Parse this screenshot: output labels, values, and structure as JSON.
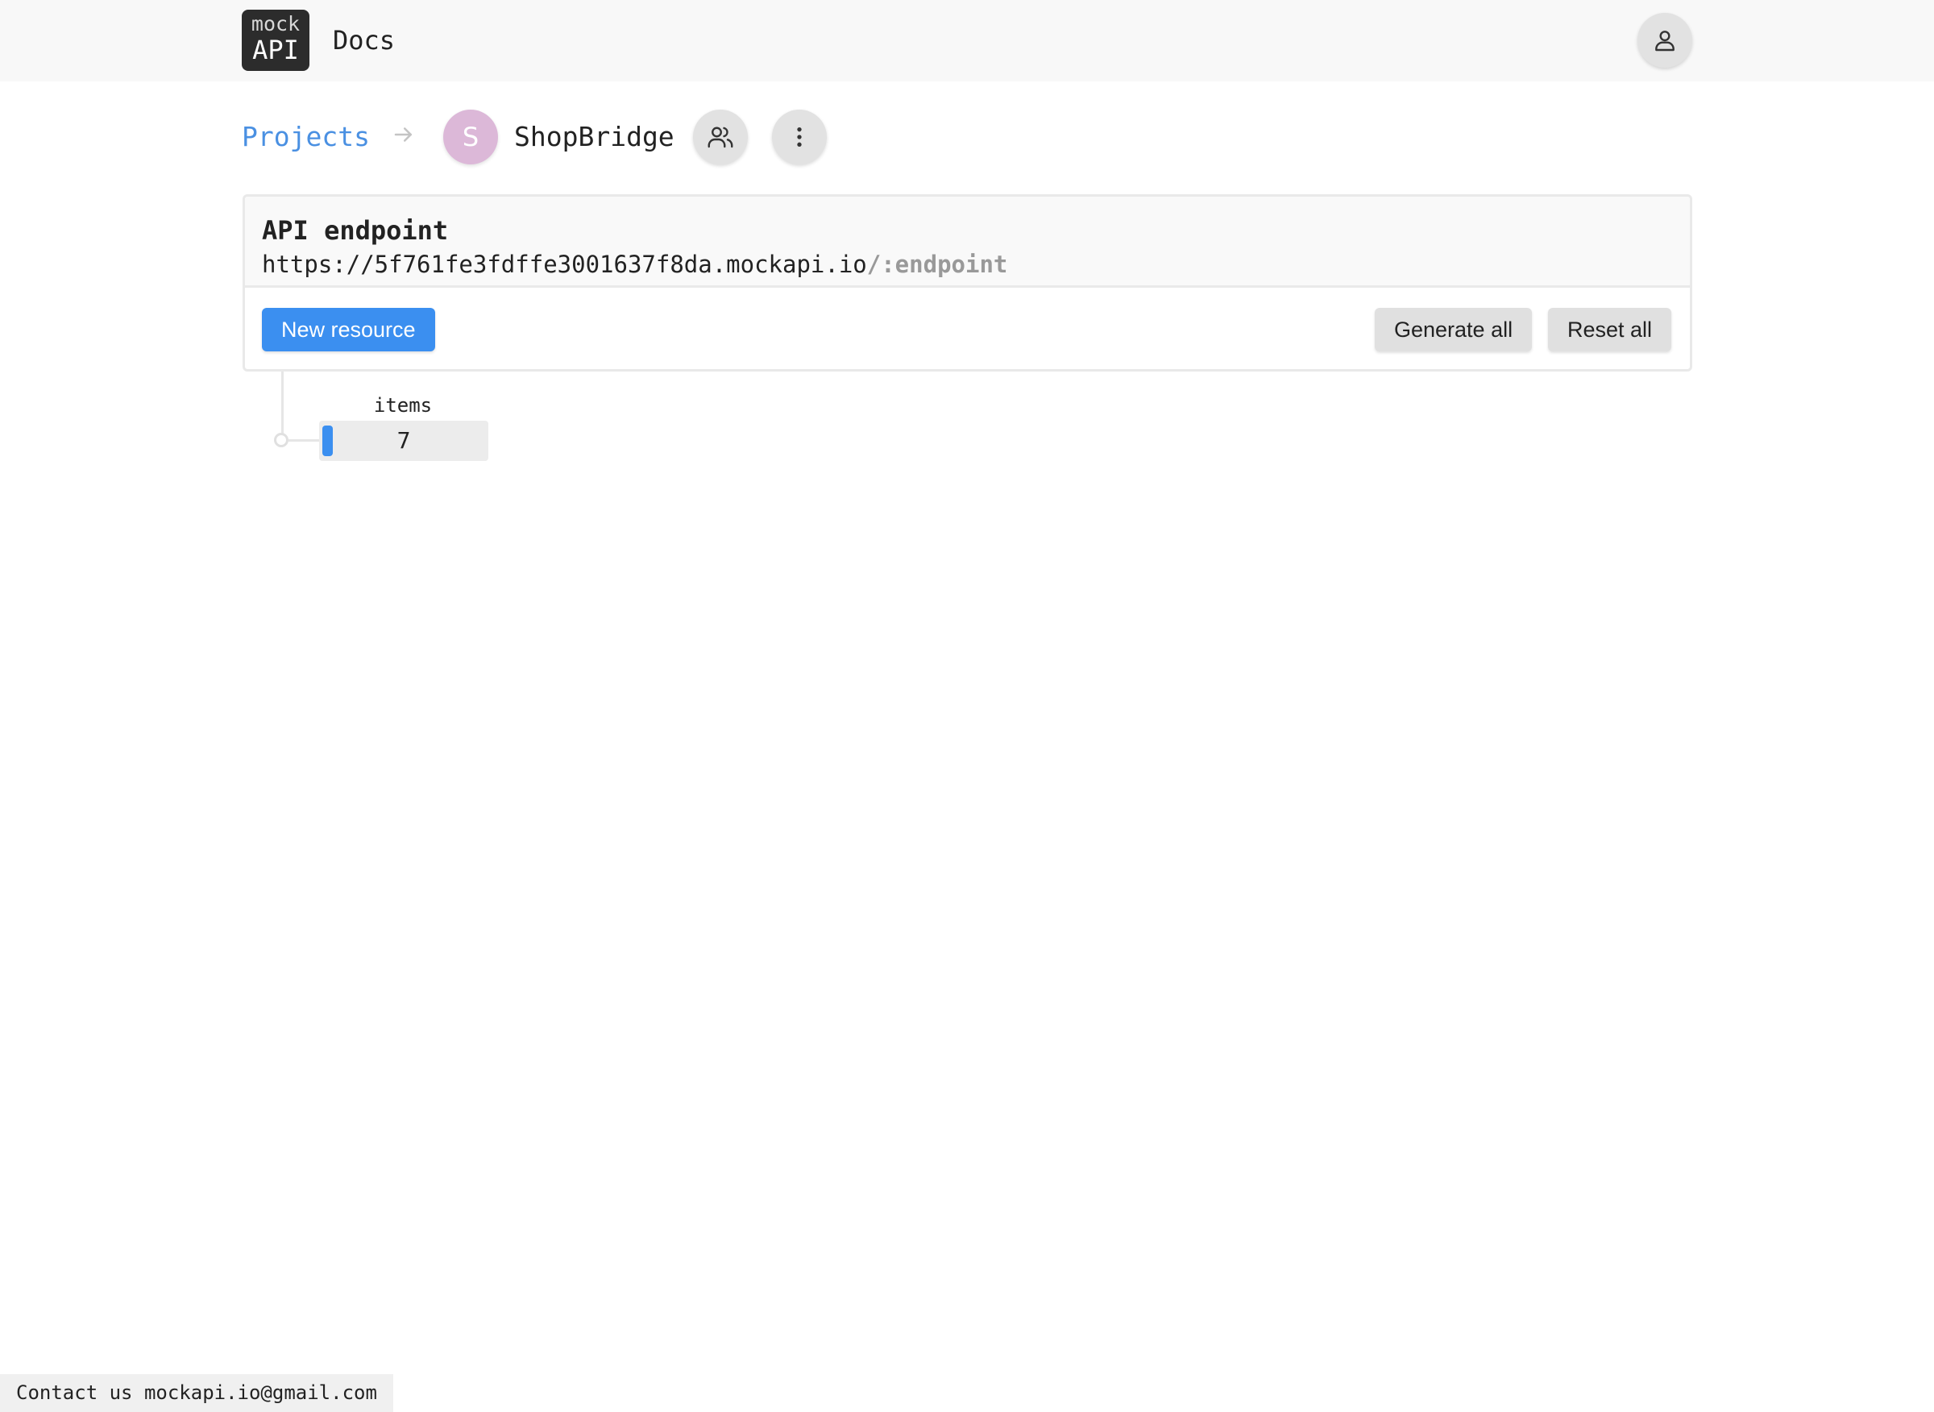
{
  "header": {
    "logo_top": "mock",
    "logo_bottom": "API",
    "docs_label": "Docs"
  },
  "breadcrumb": {
    "projects_label": "Projects",
    "project_initial": "S",
    "project_name": "ShopBridge"
  },
  "endpoint_card": {
    "title": "API endpoint",
    "base_url": "https://5f761fe3fdffe3001637f8da.mockapi.io",
    "suffix": "/:endpoint",
    "new_resource_label": "New resource",
    "generate_all_label": "Generate all",
    "reset_all_label": "Reset all"
  },
  "resources": [
    {
      "name": "items",
      "count": "7"
    }
  ],
  "footer": {
    "contact_text": "Contact us mockapi.io@gmail.com"
  },
  "colors": {
    "accent": "#3b8ff0",
    "link": "#4a90e2",
    "avatar": "#dcb8d8"
  },
  "icons": [
    "user-icon",
    "arrow-right-icon",
    "users-icon",
    "more-vertical-icon"
  ]
}
